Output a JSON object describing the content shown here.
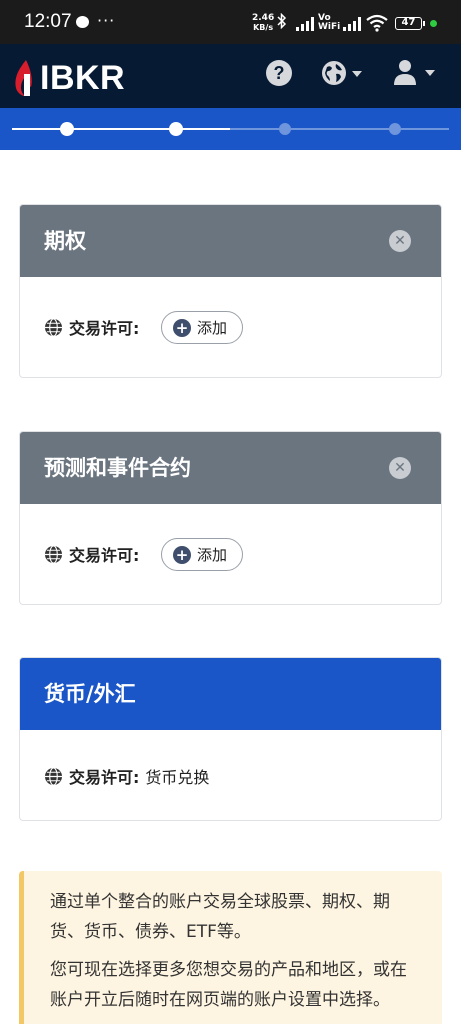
{
  "status_bar": {
    "time": "12:07",
    "overflow": "···",
    "net_speed_value": "2.46",
    "net_speed_unit": "KB/s",
    "vowifi_top": "Vo",
    "vowifi_bottom": "WiFi",
    "battery": "47"
  },
  "header": {
    "logo_text": "IBKR"
  },
  "progress": {
    "steps_total": 4,
    "steps_completed": 2
  },
  "cards": [
    {
      "title": "期权",
      "perm_label": "交易许可:",
      "add_label": "添加"
    },
    {
      "title": "预测和事件合约",
      "perm_label": "交易许可:",
      "add_label": "添加"
    },
    {
      "title": "货币/外汇",
      "perm_label": "交易许可:",
      "perm_value": "货币兑换"
    }
  ],
  "info": {
    "paragraph1": "通过单个整合的账户交易全球股票、期权、期货、货币、债券、ETF等。",
    "paragraph2": "您可现在选择更多您想交易的产品和地区，或在账户开立后随时在网页端的账户设置中选择。"
  },
  "colors": {
    "header_bg": "#071a33",
    "accent_blue": "#1a56c7",
    "card_head_gray": "#6b7580",
    "logo_red": "#d81e2c",
    "info_bg": "#fdf4e1",
    "info_border": "#f3c765"
  }
}
